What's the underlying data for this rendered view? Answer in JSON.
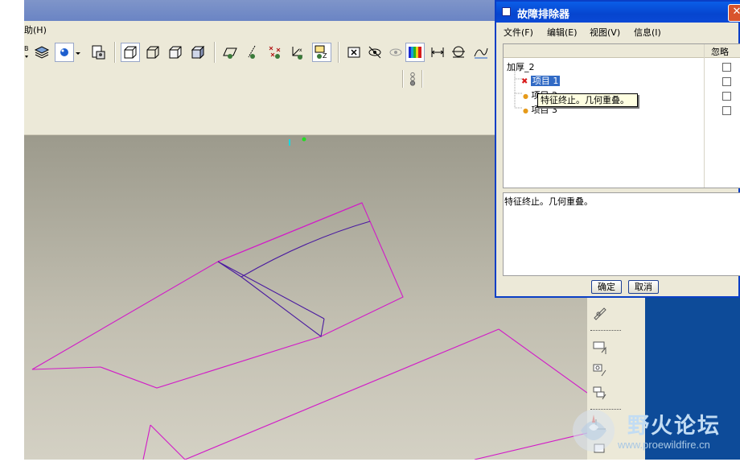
{
  "app": {
    "menu": {
      "help_label": "助(H)"
    }
  },
  "dialog": {
    "title": "故障排除器",
    "close_glyph": "✕",
    "menu": [
      "文件(F)",
      "编辑(E)",
      "视图(V)",
      "信息(I)"
    ],
    "columns": {
      "ignore": "忽略"
    },
    "tree": {
      "root": "加厚_2",
      "items": [
        {
          "label": "项目 1",
          "status": "error",
          "selected": true
        },
        {
          "label": "项目 2",
          "status": "warning",
          "selected": false
        },
        {
          "label": "项目 3",
          "status": "warning",
          "selected": false
        }
      ]
    },
    "message": "特征终止。几何重叠。",
    "buttons": {
      "ok": "确定",
      "cancel": "取消"
    }
  },
  "tooltip": {
    "text": "特征终止。几何重叠。"
  },
  "watermark": {
    "title": "野火论坛",
    "url": "www.proewildfire.cn"
  },
  "colors": {
    "dialog_title": "#0645cf",
    "geometry_magenta": "#d21ac8",
    "geometry_purple": "#4a1aa0",
    "background_blue": "#0d4b99"
  }
}
